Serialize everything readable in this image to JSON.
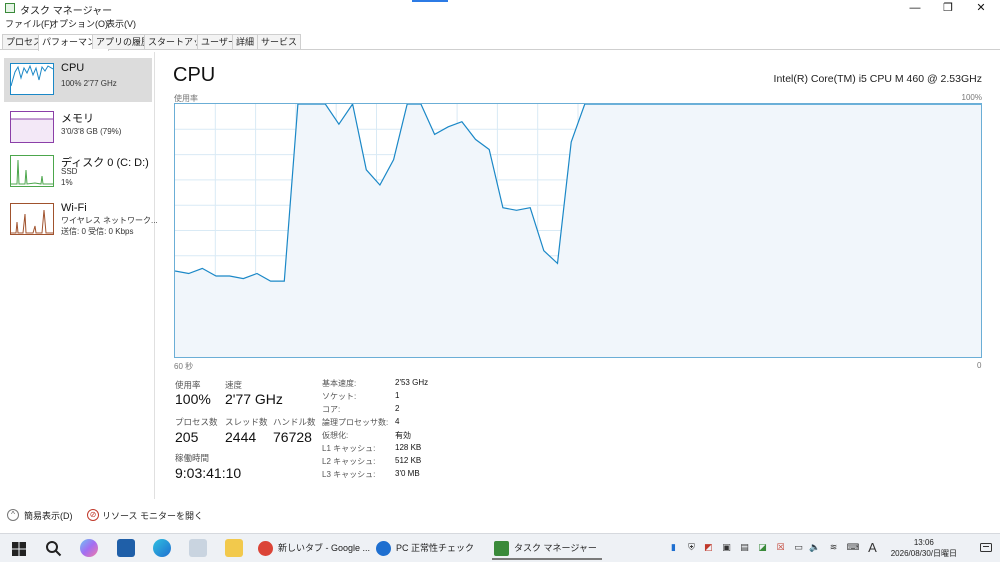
{
  "window": {
    "title": "タスク マネージャー",
    "controls": [
      "—",
      "❐",
      "✕"
    ]
  },
  "menu": [
    "ファイル(F)",
    "オプション(O)",
    "表示(V)"
  ],
  "tabs": [
    "プロセス",
    "パフォーマンス",
    "アプリの履歴",
    "スタートアップ",
    "ユーザー",
    "詳細",
    "サービス"
  ],
  "active_tab": "パフォーマンス",
  "sidebar": {
    "cpu": {
      "title": "CPU",
      "sub": "100% 2'77 GHz",
      "color": "#1b88c7"
    },
    "memory": {
      "title": "メモリ",
      "sub": "3'0/3'8 GB (79%)",
      "color": "#8b3fa8"
    },
    "disk": {
      "title": "ディスク 0 (C: D:)",
      "sub1": "SSD",
      "sub2": "1%",
      "color": "#4ca64c"
    },
    "wifi": {
      "title": "Wi-Fi",
      "sub1": "ワイヤレス ネットワーク...",
      "sub2": "送信: 0 受信: 0 Kbps",
      "color": "#a0522d"
    }
  },
  "main": {
    "title": "CPU",
    "model": "Intel(R) Core(TM) i5 CPU M 460 @ 2.53GHz",
    "usage_label": "使用率",
    "max_label": "100%",
    "time_label": "60 秒",
    "zero_label": "0"
  },
  "chart_data": {
    "type": "area",
    "x_range": [
      60,
      0
    ],
    "ylim": [
      0,
      100
    ],
    "grid": true,
    "color": "#1b88c7",
    "values": [
      34,
      33,
      35,
      32,
      32,
      31,
      33,
      30,
      30,
      100,
      100,
      100,
      92,
      100,
      74,
      68,
      78,
      100,
      100,
      88,
      91,
      93,
      86,
      82,
      59,
      58,
      59,
      42,
      37,
      85,
      100,
      100,
      100,
      100,
      100,
      100,
      100,
      100,
      100,
      100,
      100,
      100,
      100,
      100,
      100,
      100,
      100,
      100,
      100,
      100,
      100,
      100,
      100,
      100,
      100,
      100,
      100,
      100,
      100,
      100
    ]
  },
  "stats": {
    "usage": {
      "label": "使用率",
      "value": "100%"
    },
    "speed": {
      "label": "速度",
      "value": "2'77 GHz"
    },
    "processes": {
      "label": "プロセス数",
      "value": "205"
    },
    "threads": {
      "label": "スレッド数",
      "value": "2444"
    },
    "handles": {
      "label": "ハンドル数",
      "value": "76728"
    },
    "uptime": {
      "label": "稼働時間",
      "value": "9:03:41:10"
    }
  },
  "details": [
    {
      "label": "基本速度:",
      "value": "2'53 GHz"
    },
    {
      "label": "ソケット:",
      "value": "1"
    },
    {
      "label": "コア:",
      "value": "2"
    },
    {
      "label": "論理プロセッサ数:",
      "value": "4"
    },
    {
      "label": "仮想化:",
      "value": "有効"
    },
    {
      "label": "L1 キャッシュ:",
      "value": "128 KB"
    },
    {
      "label": "L2 キャッシュ:",
      "value": "512 KB"
    },
    {
      "label": "L3 キャッシュ:",
      "value": "3'0 MB"
    }
  ],
  "footer": {
    "simple_view": "簡易表示(D)",
    "resource_monitor": "リソース モニターを開く"
  },
  "taskbar": {
    "apps": [
      {
        "label": "新しいタブ - Google ...",
        "color": "#db4437"
      },
      {
        "label": "PC 正常性チェック",
        "color": "#1e6fd0"
      },
      {
        "label": "タスク マネージャー",
        "color": "#3a8a3a"
      }
    ],
    "tray_lang": "A",
    "clock_time": "13:06",
    "clock_date": "2026/08/30/日曜日"
  }
}
